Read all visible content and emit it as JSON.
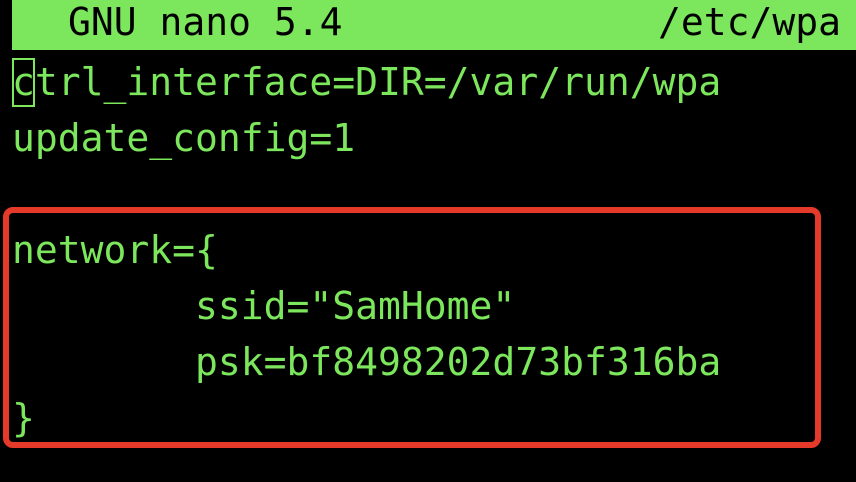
{
  "titlebar": {
    "app": "GNU nano 5.4",
    "file": "/etc/wpa"
  },
  "editor": {
    "lines": [
      "ctrl_interface=DIR=/var/run/wpa",
      "update_config=1",
      "",
      "network={",
      "        ssid=\"SamHome\"",
      "        psk=bf8498202d73bf316ba",
      "}"
    ]
  },
  "colors": {
    "terminal_bg": "#000000",
    "text_green": "#7ce65c",
    "annotation_red": "#e53a2a"
  }
}
